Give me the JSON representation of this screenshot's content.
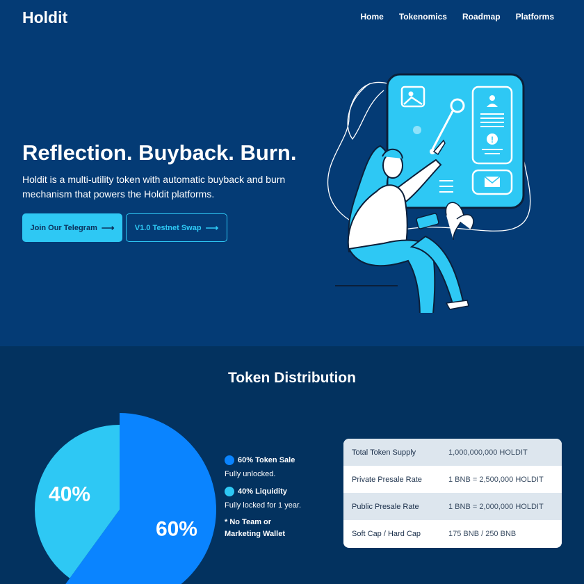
{
  "nav": {
    "logo": "Holdit",
    "links": [
      "Home",
      "Tokenomics",
      "Roadmap",
      "Platforms"
    ]
  },
  "hero": {
    "title": "Reflection. Buyback. Burn.",
    "description": "Holdit is a multi-utility token with automatic buyback and burn mechanism that powers the Holdit platforms.",
    "primary_button": "Join Our Telegram",
    "secondary_button": "V1.0 Testnet Swap",
    "arrow_icon": "arrow-right-icon"
  },
  "distribution": {
    "title": "Token Distribution",
    "legend": [
      {
        "label": "60% Token Sale",
        "sub": "Fully unlocked.",
        "color": "#0a84ff"
      },
      {
        "label": "40% Liquidity",
        "sub": "Fully locked for 1 year.",
        "color": "#2ec8f4"
      }
    ],
    "note": "* No Team or Marketing Wallet",
    "table": [
      {
        "key": "Total Token Supply",
        "value": "1,000,000,000 HOLDIT"
      },
      {
        "key": "Private Presale Rate",
        "value": "1 BNB = 2,500,000 HOLDIT"
      },
      {
        "key": "Public Presale Rate",
        "value": "1 BNB = 2,000,000 HOLDIT"
      },
      {
        "key": "Soft Cap / Hard Cap",
        "value": "175 BNB / 250 BNB"
      }
    ]
  },
  "chart_data": {
    "type": "pie",
    "categories": [
      "Token Sale",
      "Liquidity"
    ],
    "values": [
      60,
      40
    ],
    "labels": [
      "60%",
      "40%"
    ],
    "colors": [
      "#0a84ff",
      "#2ec8f4"
    ]
  },
  "colors": {
    "hero_bg": "#043b75",
    "section_bg": "#03325f",
    "accent": "#2ec8f4",
    "primary_blue": "#0a84ff"
  }
}
